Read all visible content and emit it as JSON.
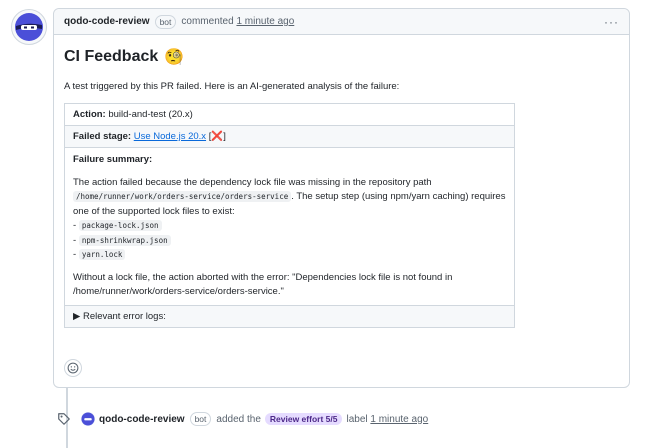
{
  "comment": {
    "author": "qodo-code-review",
    "badge": "bot",
    "action": "commented",
    "time": "1 minute ago",
    "menu": "···",
    "title": "CI Feedback",
    "title_emoji": "🧐",
    "intro": "A test triggered by this PR failed. Here is an AI-generated analysis of the failure:",
    "action_label": "Action:",
    "action_value": "build-and-test (20.x)",
    "failed_label": "Failed stage:",
    "failed_link": "Use Node.js 20.x",
    "failed_open": "[",
    "failed_x": "❌",
    "failed_close": "]",
    "summary_label": "Failure summary:",
    "summary_1": "The action failed because the dependency lock file was missing in the repository path",
    "summary_path": "/home/runner/work/orders-service/orders-service",
    "summary_2": ". The setup step (using npm/yarn caching) requires one of the supported lock files to exist:",
    "lock_files": [
      "package-lock.json",
      "npm-shrinkwrap.json",
      "yarn.lock"
    ],
    "summary_3": "Without a lock file, the action aborted with the error: \"Dependencies lock file is not found in /home/runner/work/orders-service/orders-service.\"",
    "logs_label": "Relevant error logs:",
    "logs_marker": "▶"
  },
  "event": {
    "author": "qodo-code-review",
    "badge": "bot",
    "text_before": "added the",
    "label": "Review effort 5/5",
    "text_after": "label",
    "time": "1 minute ago"
  },
  "colors": {
    "link": "#0969da",
    "label_bg": "#e5dbff",
    "label_fg": "#4c2889",
    "border": "#d0d7de"
  }
}
